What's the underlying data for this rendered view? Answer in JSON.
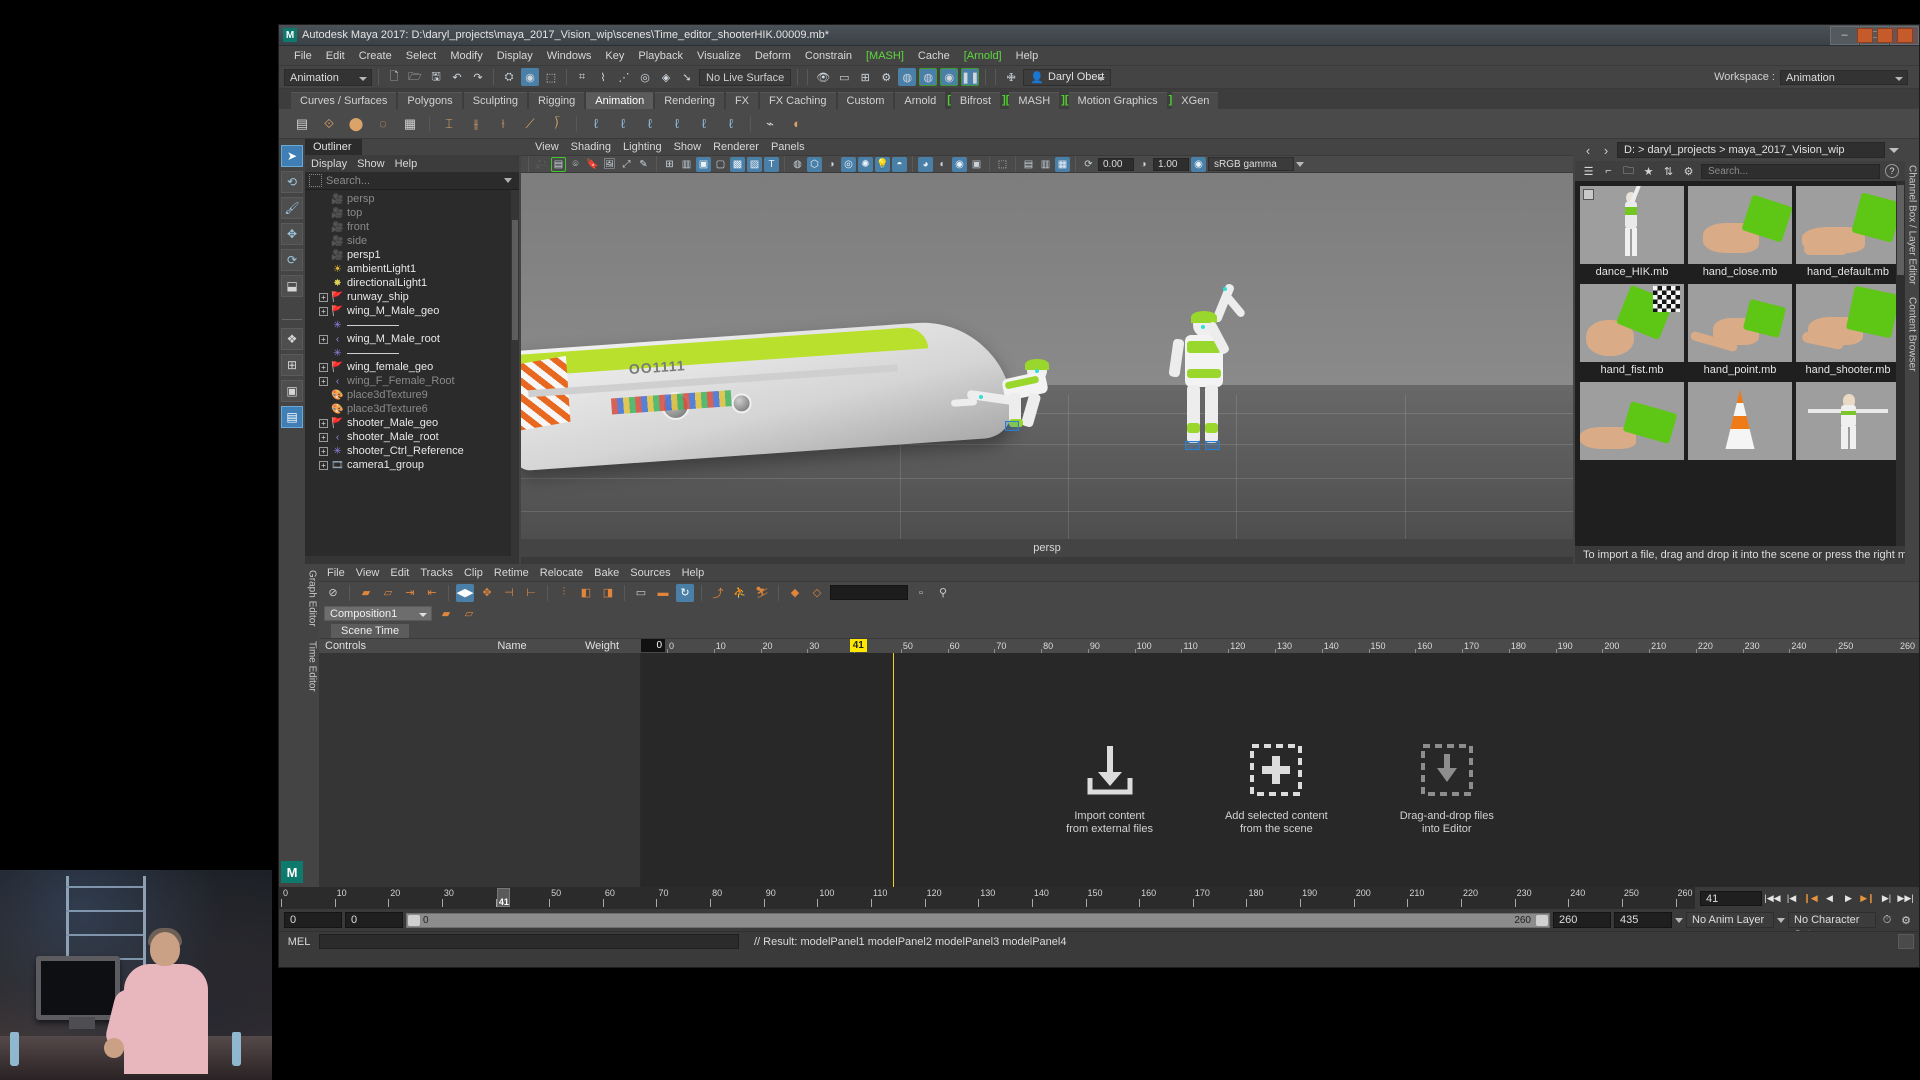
{
  "window": {
    "title": "Autodesk Maya 2017: D:\\daryl_projects\\maya_2017_Vision_wip\\scenes\\Time_editor_shooterHIK.00009.mb*",
    "logo": "M",
    "minimize": "–",
    "maximize": "□",
    "close": "✕"
  },
  "menubar": {
    "items": [
      {
        "label": "File",
        "plugin": false
      },
      {
        "label": "Edit",
        "plugin": false
      },
      {
        "label": "Create",
        "plugin": false
      },
      {
        "label": "Select",
        "plugin": false
      },
      {
        "label": "Modify",
        "plugin": false
      },
      {
        "label": "Display",
        "plugin": false
      },
      {
        "label": "Windows",
        "plugin": false
      },
      {
        "label": "Key",
        "plugin": false
      },
      {
        "label": "Playback",
        "plugin": false
      },
      {
        "label": "Visualize",
        "plugin": false
      },
      {
        "label": "Deform",
        "plugin": false
      },
      {
        "label": "Constrain",
        "plugin": false
      },
      {
        "label": "[MASH]",
        "plugin": true
      },
      {
        "label": "Cache",
        "plugin": false
      },
      {
        "label": "[Arnold]",
        "plugin": true
      },
      {
        "label": "Help",
        "plugin": false
      }
    ],
    "workspace_label": "Workspace :",
    "workspace_value": "Animation"
  },
  "statusbar": {
    "mode": "Animation",
    "live_surface": "No Live Surface",
    "user": "Daryl Obert",
    "user_icon": "person-icon"
  },
  "shelf": {
    "tabs": [
      {
        "label": "Curves / Surfaces",
        "active": false,
        "bracket": false
      },
      {
        "label": "Polygons",
        "active": false,
        "bracket": false
      },
      {
        "label": "Sculpting",
        "active": false,
        "bracket": false
      },
      {
        "label": "Rigging",
        "active": false,
        "bracket": false
      },
      {
        "label": "Animation",
        "active": true,
        "bracket": false
      },
      {
        "label": "Rendering",
        "active": false,
        "bracket": false
      },
      {
        "label": "FX",
        "active": false,
        "bracket": false
      },
      {
        "label": "FX Caching",
        "active": false,
        "bracket": false
      },
      {
        "label": "Custom",
        "active": false,
        "bracket": false
      },
      {
        "label": "Arnold",
        "active": false,
        "bracket": false
      },
      {
        "label": "Bifrost",
        "active": false,
        "bracket": true
      },
      {
        "label": "MASH",
        "active": false,
        "bracket": true
      },
      {
        "label": "Motion Graphics",
        "active": false,
        "bracket": true
      },
      {
        "label": "XGen",
        "active": false,
        "bracket": false
      }
    ]
  },
  "outliner": {
    "tab": "Outliner",
    "menu": [
      "Display",
      "Show",
      "Help"
    ],
    "search_placeholder": "Search...",
    "items": [
      {
        "label": "persp",
        "icon": "camera-icon",
        "expand": false,
        "dim": true
      },
      {
        "label": "top",
        "icon": "camera-icon",
        "expand": false,
        "dim": true
      },
      {
        "label": "front",
        "icon": "camera-icon",
        "expand": false,
        "dim": true
      },
      {
        "label": "side",
        "icon": "camera-icon",
        "expand": false,
        "dim": true
      },
      {
        "label": "persp1",
        "icon": "camera-icon",
        "expand": false,
        "dim": false
      },
      {
        "label": "ambientLight1",
        "icon": "ambient-light-icon",
        "expand": false,
        "dim": false
      },
      {
        "label": "directionalLight1",
        "icon": "directional-light-icon",
        "expand": false,
        "dim": false
      },
      {
        "label": "runway_ship",
        "icon": "mesh-group-icon",
        "expand": true,
        "dim": false
      },
      {
        "label": "wing_M_Male_geo",
        "icon": "mesh-group-icon",
        "expand": true,
        "dim": false
      },
      {
        "label": "",
        "icon": "asterisk-icon",
        "expand": false,
        "dim": false,
        "rule": true
      },
      {
        "label": "wing_M_Male_root",
        "icon": "joint-icon",
        "expand": true,
        "dim": false
      },
      {
        "label": "",
        "icon": "asterisk-icon",
        "expand": false,
        "dim": false,
        "rule": true
      },
      {
        "label": "wing_female_geo",
        "icon": "mesh-group-icon",
        "expand": true,
        "dim": false
      },
      {
        "label": "wing_F_Female_Root",
        "icon": "joint-icon",
        "expand": true,
        "dim": true
      },
      {
        "label": "place3dTexture9",
        "icon": "texture-icon",
        "expand": false,
        "dim": true
      },
      {
        "label": "place3dTexture6",
        "icon": "texture-icon",
        "expand": false,
        "dim": true
      },
      {
        "label": "shooter_Male_geo",
        "icon": "mesh-group-icon",
        "expand": true,
        "dim": false
      },
      {
        "label": "shooter_Male_root",
        "icon": "joint-icon",
        "expand": true,
        "dim": false
      },
      {
        "label": "shooter_Ctrl_Reference",
        "icon": "asterisk-icon",
        "expand": true,
        "dim": false
      },
      {
        "label": "camera1_group",
        "icon": "camera-group-icon",
        "expand": true,
        "dim": false
      }
    ]
  },
  "viewport": {
    "menu": [
      "View",
      "Shading",
      "Lighting",
      "Show",
      "Renderer",
      "Panels"
    ],
    "exposure": "0.00",
    "gamma_value": "1.00",
    "color_space": "sRGB gamma",
    "label": "persp",
    "ship_text": "OO1111"
  },
  "content_browser": {
    "path": "D:  >  daryl_projects  >  maya_2017_Vision_wip",
    "back_icon": "chevron-left-icon",
    "forward_icon": "chevron-right-icon",
    "search_placeholder": "Search...",
    "help_icon": "question-icon",
    "side_tabs": [
      "Channel Box / Layer Editor",
      "Content Browser"
    ],
    "status": "To import a file, drag and drop it into the scene or press the right mouse button for i",
    "items": [
      {
        "label": "dance_HIK.mb",
        "thumb": "figure"
      },
      {
        "label": "hand_close.mb",
        "thumb": "hand-close"
      },
      {
        "label": "hand_default.mb",
        "thumb": "hand-default"
      },
      {
        "label": "hand_fist.mb",
        "thumb": "hand-fist"
      },
      {
        "label": "hand_point.mb",
        "thumb": "hand-point"
      },
      {
        "label": "hand_shooter.mb",
        "thumb": "hand-shooter"
      },
      {
        "label": "",
        "thumb": "hand-open"
      },
      {
        "label": "",
        "thumb": "cone"
      },
      {
        "label": "",
        "thumb": "figure-t"
      }
    ]
  },
  "time_editor": {
    "side_tabs": [
      "Graph Editor",
      "Time Editor"
    ],
    "menu": [
      "File",
      "View",
      "Edit",
      "Tracks",
      "Clip",
      "Retime",
      "Relocate",
      "Bake",
      "Sources",
      "Help"
    ],
    "composition": "Composition1",
    "scene_time_tab": "Scene Time",
    "columns": [
      "Controls",
      "Name",
      "Weight"
    ],
    "ruler_start": "0",
    "current_frame": "41",
    "ruler_end": "260",
    "ruler_ticks": [
      "0",
      "10",
      "20",
      "30",
      "40",
      "50",
      "60",
      "70",
      "80",
      "90",
      "100",
      "110",
      "120",
      "130",
      "140",
      "150",
      "160",
      "170",
      "180",
      "190",
      "200",
      "210",
      "220",
      "230",
      "240",
      "250"
    ],
    "hints": [
      {
        "icon": "import-arrow-icon",
        "line1": "Import content",
        "line2": "from external files"
      },
      {
        "icon": "add-plus-icon",
        "line1": "Add selected content",
        "line2": "from the scene"
      },
      {
        "icon": "drag-drop-icon",
        "line1": "Drag-and-drop files",
        "line2": "into Editor"
      }
    ]
  },
  "timeline": {
    "ticks": [
      "0",
      "10",
      "20",
      "30",
      "40",
      "50",
      "60",
      "70",
      "80",
      "90",
      "100",
      "110",
      "120",
      "130",
      "140",
      "150",
      "160",
      "170",
      "180",
      "190",
      "200",
      "210",
      "220",
      "230",
      "240",
      "250",
      "260"
    ],
    "current_frame": "41",
    "current_frame_field": "41",
    "playback_buttons": [
      "go-to-start-icon",
      "step-back-key-icon",
      "step-back-frame-icon",
      "play-backwards-icon",
      "play-forwards-icon",
      "step-forward-frame-icon",
      "step-forward-key-icon",
      "go-to-end-icon"
    ]
  },
  "range": {
    "start": "0",
    "anim_start": "0",
    "slider_min": "0",
    "slider_max": "260",
    "anim_end": "260",
    "end": "435",
    "anim_layer": "No Anim Layer",
    "character_set": "No Character Set",
    "icons": [
      "auto-key-icon",
      "animation-prefs-icon"
    ]
  },
  "command_line": {
    "language": "MEL",
    "input": "",
    "output": "// Result: modelPanel1 modelPanel2 modelPanel3 modelPanel4"
  },
  "colors": {
    "accent_blue": "#4a7fa8",
    "orange": "#e0853c",
    "plugin_green": "#5ed93f",
    "current_frame_yellow": "#ffe800",
    "panel_bg": "#444444",
    "dark_bg": "#2b2b2b"
  }
}
